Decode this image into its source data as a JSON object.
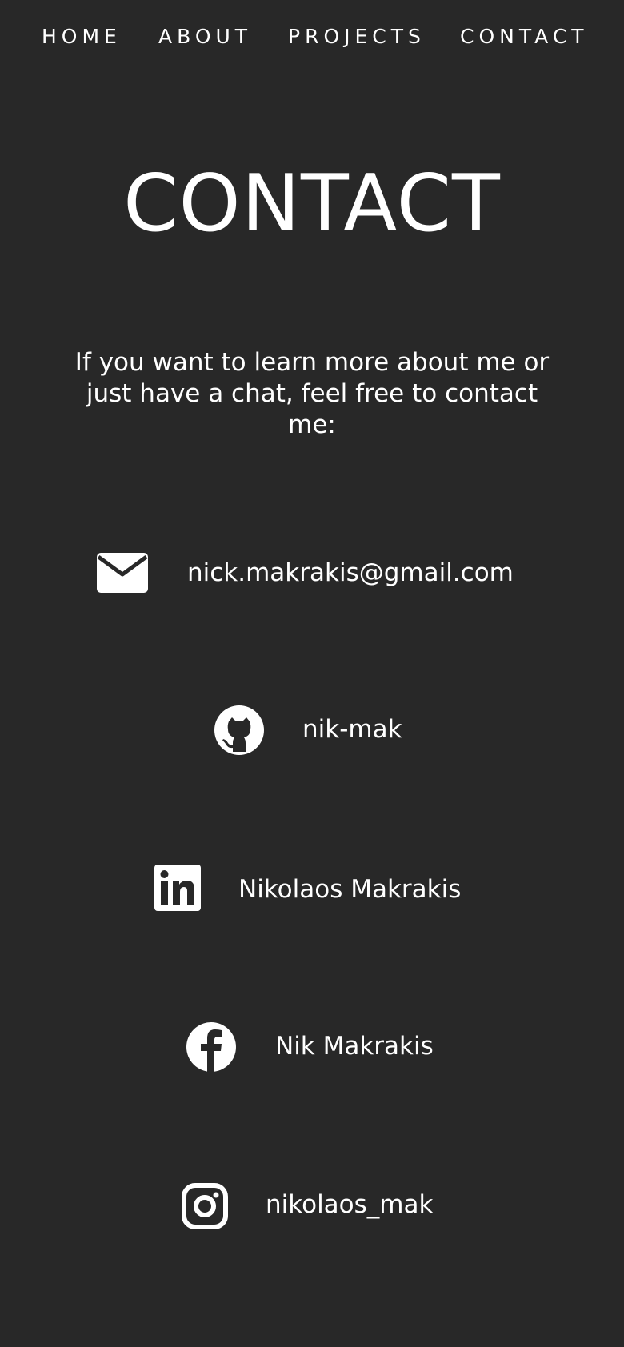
{
  "nav": {
    "items": [
      {
        "label": "HOME"
      },
      {
        "label": "ABOUT"
      },
      {
        "label": "PROJECTS"
      },
      {
        "label": "CONTACT"
      }
    ]
  },
  "page": {
    "title": "CONTACT",
    "intro": "If you want to learn more about me or just have a chat, feel free to contact me:"
  },
  "contacts": [
    {
      "icon": "envelope-icon",
      "text": "nick.makrakis@gmail.com"
    },
    {
      "icon": "github-icon",
      "text": "nik-mak"
    },
    {
      "icon": "linkedin-icon",
      "text": "Nikolaos Makrakis"
    },
    {
      "icon": "facebook-icon",
      "text": "Nik Makrakis"
    },
    {
      "icon": "instagram-icon",
      "text": "nikolaos_mak"
    }
  ],
  "colors": {
    "background": "#282828",
    "text": "#ffffff"
  }
}
